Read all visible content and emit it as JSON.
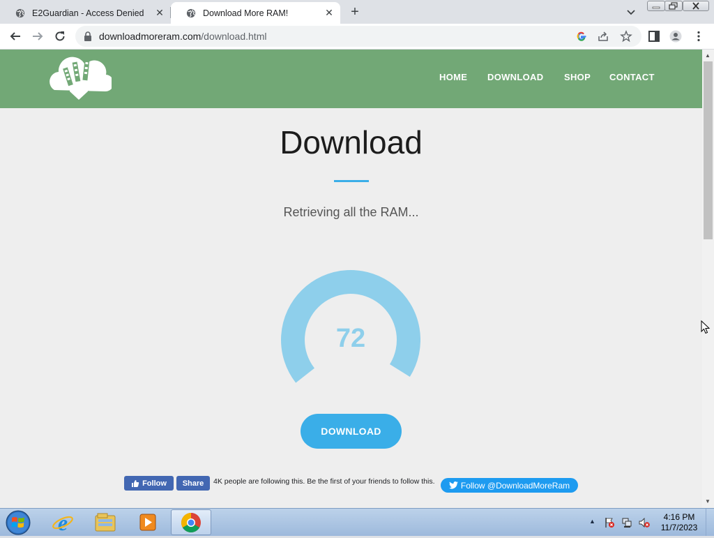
{
  "browser": {
    "tabs": [
      {
        "title": "E2Guardian - Access Denied",
        "active": false
      },
      {
        "title": "Download More RAM!",
        "active": true
      }
    ],
    "new_tab_glyph": "+",
    "close_glyph": "✕",
    "url": {
      "host": "downloadmoreram.com",
      "path": "/download.html"
    }
  },
  "site": {
    "nav": [
      {
        "label": "HOME"
      },
      {
        "label": "DOWNLOAD"
      },
      {
        "label": "SHOP"
      },
      {
        "label": "CONTACT"
      }
    ],
    "title": "Download",
    "status": "Retrieving all the RAM...",
    "progress": {
      "value": "72",
      "fraction": 0.72
    },
    "download_button": "DOWNLOAD",
    "social": {
      "fb_follow": "Follow",
      "fb_share": "Share",
      "fb_text": "4K people are following this. Be the first of your friends to follow this.",
      "twitter": "Follow @DownloadMoreRam"
    }
  },
  "taskbar": {
    "time": "4:16 PM",
    "date": "11/7/2023",
    "tray_arrow": "▲"
  },
  "colors": {
    "header_green": "#72a876",
    "accent_blue": "#3aaee8",
    "gauge_blue": "#8ecfeb",
    "facebook": "#4267b2",
    "twitter": "#1d9bf0"
  }
}
